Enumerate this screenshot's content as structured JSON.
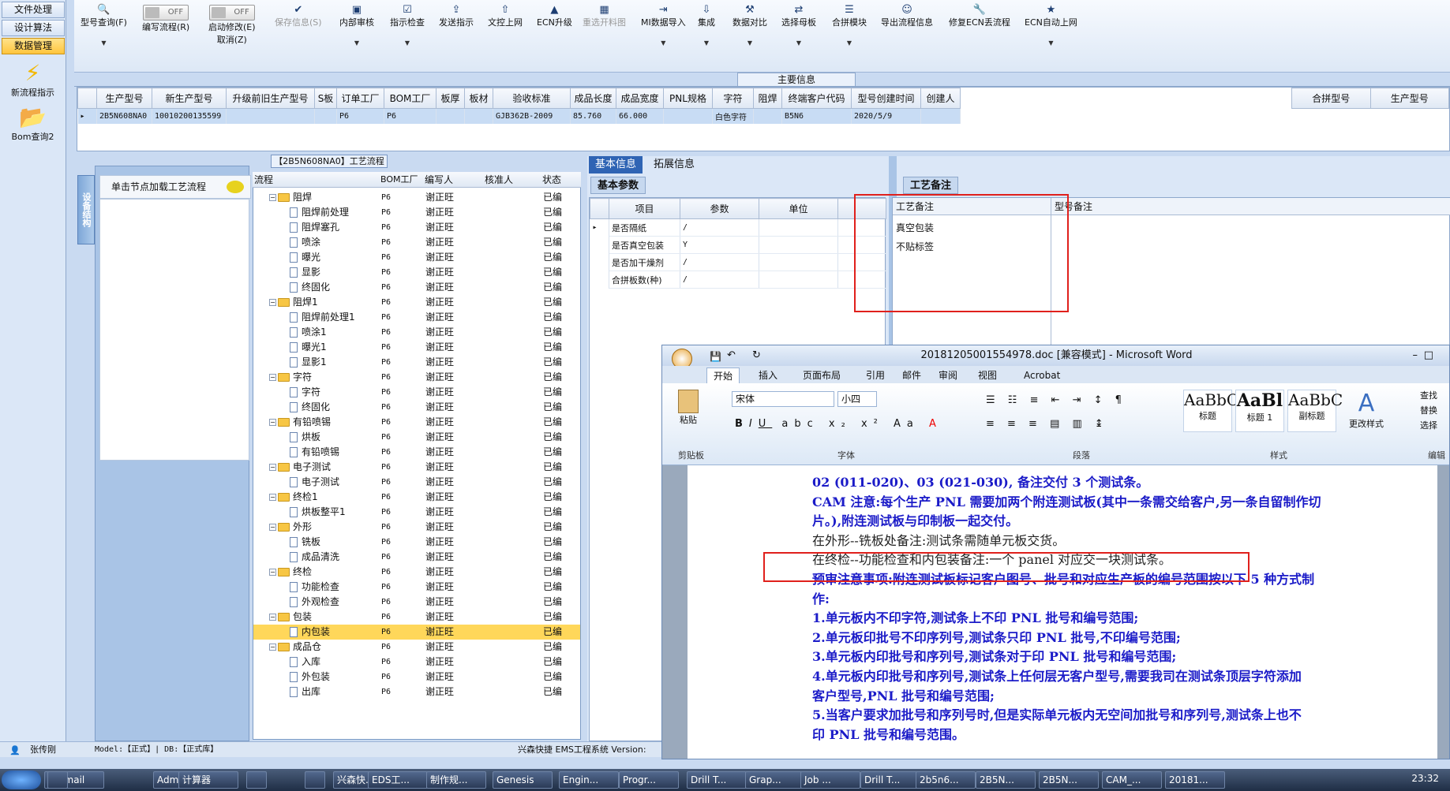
{
  "nav": {
    "items": [
      "文件处理",
      "设计算法",
      "数据管理"
    ],
    "icon1": "新流程指示",
    "icon2": "Bom查询2"
  },
  "toolbar": {
    "type_query": "型号查询(F)",
    "edit_flow": "编写流程(R)",
    "start_modify": "启动修改(E)",
    "cancel": "取消(Z)",
    "off": "OFF",
    "save": "保存信息(S)",
    "internal_audit": "内部审核",
    "ind_check": "指示检查",
    "send_ind": "发送指示",
    "upload": "文控上网",
    "ecn_upgrade": "ECN升级",
    "reopen": "重选开料图",
    "mi_import": "MI数据导入",
    "integrate": "集成",
    "compare": "数据对比",
    "select_mother": "选择母板",
    "merge": "合拼模块",
    "export_flow": "导出流程信息",
    "fix_ecn": "修复ECN丢流程",
    "ecn_auto": "ECN自动上网"
  },
  "main_info": "主要信息",
  "grid": {
    "headers": [
      "生产型号",
      "新生产型号",
      "升级前旧生产型号",
      "S板",
      "订单工厂",
      "BOM工厂",
      "板厚",
      "板材",
      "验收标准",
      "成品长度",
      "成品宽度",
      "PNL规格",
      "字符",
      "阻焊",
      "终端客户代码",
      "型号创建时间",
      "创建人"
    ],
    "row": [
      "2B5N608NA0",
      "10010200135599",
      "",
      "",
      "P6",
      "P6",
      "",
      "",
      "GJB362B-2009",
      "85.760",
      "66.000",
      "",
      "白色字符",
      "",
      "B5N6",
      "2020/5/9",
      ""
    ],
    "side_headers": [
      "合拼型号",
      "生产型号"
    ]
  },
  "flow_title": "【2B5N608NA0】工艺流程",
  "vtab": "设备结构",
  "node_btn": "单击节点加载工艺流程",
  "tree": {
    "headers": [
      "流程",
      "BOM工厂",
      "编写人",
      "核准人",
      "状态"
    ],
    "rows": [
      {
        "n": "阻焊",
        "f": true,
        "i": 1
      },
      {
        "n": "阻焊前处理",
        "i": 2
      },
      {
        "n": "阻焊塞孔",
        "i": 2
      },
      {
        "n": "喷涂",
        "i": 2
      },
      {
        "n": "曝光",
        "i": 2
      },
      {
        "n": "显影",
        "i": 2
      },
      {
        "n": "终固化",
        "i": 2
      },
      {
        "n": "阻焊1",
        "f": true,
        "i": 1
      },
      {
        "n": "阻焊前处理1",
        "i": 2
      },
      {
        "n": "喷涂1",
        "i": 2
      },
      {
        "n": "曝光1",
        "i": 2
      },
      {
        "n": "显影1",
        "i": 2
      },
      {
        "n": "字符",
        "f": true,
        "i": 1
      },
      {
        "n": "字符",
        "i": 2
      },
      {
        "n": "终固化",
        "i": 2
      },
      {
        "n": "有铅喷锡",
        "f": true,
        "i": 1
      },
      {
        "n": "烘板",
        "i": 2
      },
      {
        "n": "有铅喷锡",
        "i": 2
      },
      {
        "n": "电子测试",
        "f": true,
        "i": 1
      },
      {
        "n": "电子测试",
        "i": 2
      },
      {
        "n": "终检1",
        "f": true,
        "i": 1
      },
      {
        "n": "烘板整平1",
        "i": 2
      },
      {
        "n": "外形",
        "f": true,
        "i": 1
      },
      {
        "n": "铣板",
        "i": 2
      },
      {
        "n": "成品清洗",
        "i": 2
      },
      {
        "n": "终检",
        "f": true,
        "i": 1
      },
      {
        "n": "功能检查",
        "i": 2
      },
      {
        "n": "外观检查",
        "i": 2
      },
      {
        "n": "包装",
        "f": true,
        "i": 1
      },
      {
        "n": "内包装",
        "i": 2,
        "sel": true
      },
      {
        "n": "成品仓",
        "f": true,
        "i": 1
      },
      {
        "n": "入库",
        "i": 2
      },
      {
        "n": "外包装",
        "i": 2
      },
      {
        "n": "出库",
        "i": 2
      }
    ],
    "factory": "P6",
    "writer": "谢正旺",
    "status": "已编"
  },
  "right": {
    "tab1": "基本信息",
    "tab2": "拓展信息",
    "subtab": "基本参数",
    "cols": [
      "项目",
      "参数",
      "单位"
    ],
    "params": [
      [
        "是否隔纸",
        "/"
      ],
      [
        "是否真空包装",
        "Y"
      ],
      [
        "是否加干燥剂",
        "/"
      ],
      [
        "合拼板数(种)",
        "/"
      ]
    ],
    "craft_tab": "工艺备注",
    "craft_head": "工艺备注",
    "model_head": "型号备注",
    "notes": [
      "真空包装",
      "不贴标签"
    ]
  },
  "word": {
    "title": "20181205001554978.doc [兼容模式] - Microsoft Word",
    "tabs": [
      "开始",
      "插入",
      "页面布局",
      "引用",
      "邮件",
      "审阅",
      "视图",
      "Acrobat"
    ],
    "font": "宋体",
    "size": "小四",
    "groups": [
      "剪贴板",
      "字体",
      "段落",
      "样式",
      "编辑"
    ],
    "paste": "粘贴",
    "change_style": "更改样式",
    "styles": [
      "标题",
      "标题 1",
      "副标题"
    ],
    "find": "查找",
    "replace": "替换",
    "select": "选择",
    "lines": [
      "02 (011-020)、03 (021-030), 备注交付 3 个测试条。",
      "CAM 注意:每个生产 PNL 需要加两个附连测试板(其中一条需交给客户,另一条自留制作切",
      "片。),附连测试板与印制板一起交付。",
      "在外形--铣板处备注:测试条需随单元板交货。",
      "在终检--功能检查和内包装备注:一个 panel 对应交一块测试条。",
      "预审注意事项:附连测试板标记客户图号、批号和对应生产板的编号范围按以下 5 种方式制",
      "作:",
      "1.单元板内不印字符,测试条上不印 PNL 批号和编号范围;",
      "2.单元板印批号不印序列号,测试条只印 PNL 批号,不印编号范围;",
      "3.单元板内印批号和序列号,测试条对于印 PNL 批号和编号范围;",
      "4.单元板内印批号和序列号,测试条上任何层无客户型号,需要我司在测试条顶层字符添加",
      "客户型号,PNL 批号和编号范围;",
      "5.当客户要求加批号和序列号时,但是实际单元板内无空间加批号和序列号,测试条上也不",
      "印 PNL 批号和编号范围。"
    ]
  },
  "status": {
    "user": "张传刚",
    "model": "Model:【正式】| DB:【正式库】",
    "sys": "兴森快捷 EMS工程系统 Version:"
  },
  "taskbar": {
    "items": [
      "Foxmail",
      "",
      "Admi...",
      "计算器",
      "",
      "",
      "兴森快...",
      "EDS工...",
      "制作规...",
      "Genesis",
      "Engin...",
      "Progr...",
      "Drill T...",
      "Grap...",
      "Job ...",
      "Drill T...",
      "2b5n6...",
      "2B5N...",
      "2B5N...",
      "CAM_...",
      "20181..."
    ],
    "clock": "23:32"
  }
}
